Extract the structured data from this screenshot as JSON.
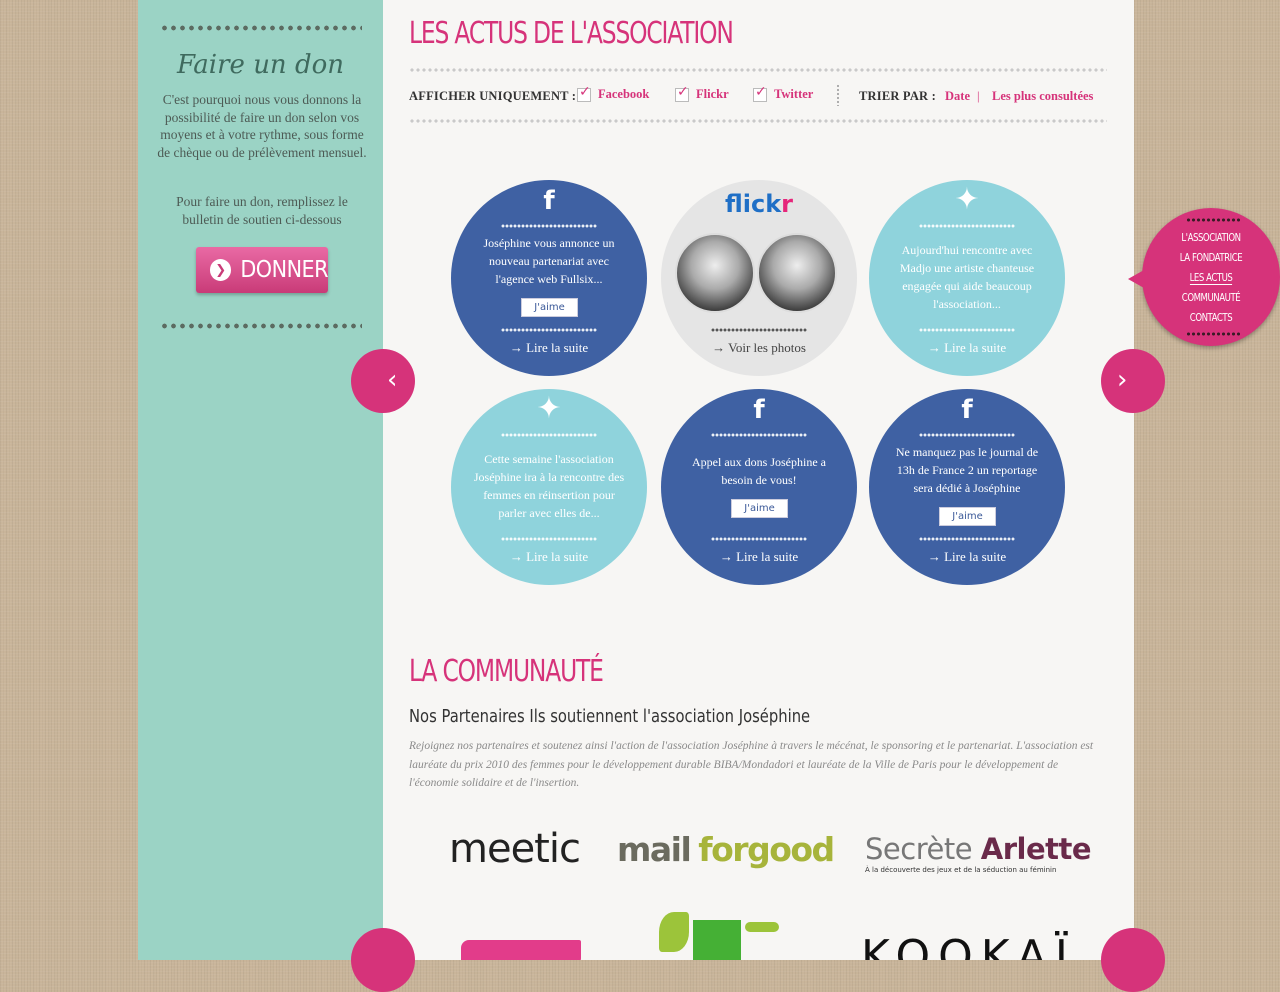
{
  "sidebar": {
    "don_title": "Faire un don",
    "don_text": "C'est pourquoi nous vous donnons la possibilité de faire un don selon vos moyens et à votre rythme, sous forme de chèque ou de prélèvement mensuel.",
    "don_text_2": "Pour faire un don, remplissez le bulletin de soutien ci-dessous",
    "donner_label": "DONNER"
  },
  "actus": {
    "title": "LES ACTUS DE L'ASSOCIATION",
    "filter_label": "AFFICHER UNIQUEMENT :",
    "filters": [
      "Facebook",
      "Flickr",
      "Twitter"
    ],
    "sort_label": "TRIER PAR :",
    "sort_options": [
      "Date",
      "Les plus consultées"
    ],
    "sort_separator": "|",
    "posts": [
      {
        "type": "facebook",
        "icon": "f",
        "text": "Joséphine vous annonce un nouveau partenariat avec l'agence web Fullsix...",
        "like": "J'aime",
        "link": "→ Lire la suite"
      },
      {
        "type": "flickr",
        "icon": "flickr",
        "text": "",
        "like": "",
        "link": "→ Voir les photos"
      },
      {
        "type": "twitter",
        "icon": "bird",
        "text": "Aujourd'hui rencontre avec Madjo une artiste chanteuse engagée qui aide beaucoup l'association...",
        "like": "",
        "link": "→ Lire la suite"
      },
      {
        "type": "twitter",
        "icon": "bird",
        "text": "Cette semaine l'association Joséphine ira à la rencontre des femmes en réinsertion pour parler avec elles de...",
        "like": "",
        "link": "→ Lire la suite"
      },
      {
        "type": "facebook",
        "icon": "f",
        "text": "Appel aux dons Joséphine a besoin de vous!",
        "like": "J'aime",
        "link": "→ Lire la suite"
      },
      {
        "type": "facebook",
        "icon": "f",
        "text": "Ne manquez pas le journal de 13h de France 2 un reportage sera dédié à Joséphine",
        "like": "J'aime",
        "link": "→ Lire la suite"
      }
    ]
  },
  "communaute": {
    "title": "LA COMMUNAUTÉ",
    "subtitle": "Nos Partenaires Ils soutiennent l'association Joséphine",
    "intro": "Rejoignez nos partenaires et soutenez ainsi l'action de l'association Joséphine à travers le mécénat, le sponsoring et le partenariat. L'association est lauréate du prix 2010 des femmes pour le développement durable BIBA/Mondadori et lauréate de la Ville de Paris pour le développement de l'économie solidaire et de l'insertion.",
    "partners": [
      {
        "name": "meetic"
      },
      {
        "name": "mail for good",
        "part1": "mail",
        "part2": "forgood"
      },
      {
        "name": "Secrète Arlette",
        "part1": "Secrète",
        "part2": "Arlette",
        "tagline": "À la découverte des jeux et de la séduction au féminin"
      },
      {
        "name": "KOOKAÏ"
      }
    ]
  },
  "nav": {
    "items": [
      "L'ASSOCIATION",
      "LA FONDATRICE",
      "LES ACTUS",
      "COMMUNAUTÉ",
      "CONTACTS"
    ],
    "active": "LES ACTUS"
  },
  "colors": {
    "pink": "#d6337a",
    "mint": "#9bd3c5",
    "facebook": "#3f61a3",
    "twitter": "#8fd3dc"
  }
}
